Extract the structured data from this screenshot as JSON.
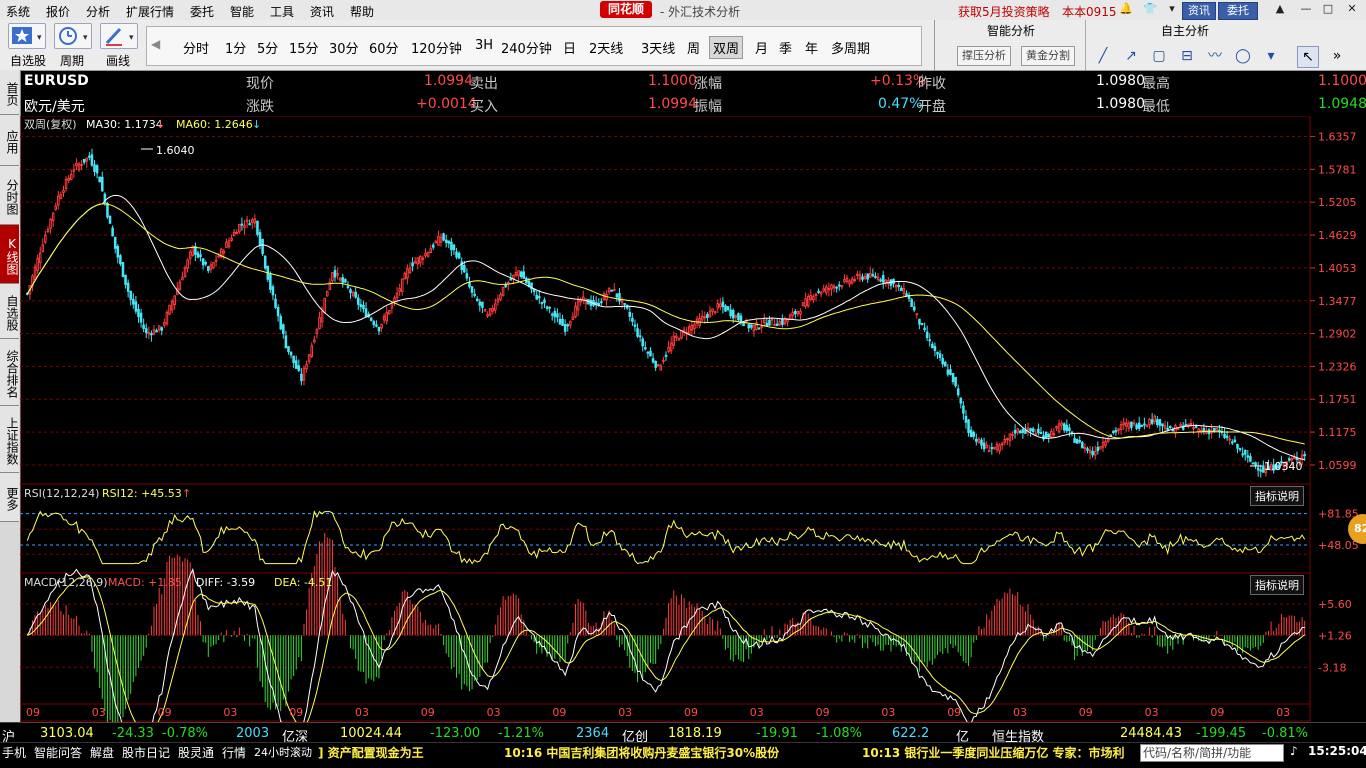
{
  "menu": [
    "系统",
    "报价",
    "分析",
    "扩展行情",
    "委托",
    "智能",
    "工具",
    "资讯",
    "帮助"
  ],
  "brand": "同花顺",
  "subtitle": "- 外汇技术分析",
  "promo": "获取5月投资策略",
  "user": "本本0915",
  "top_buttons": {
    "news": "资讯",
    "trade": "委托"
  },
  "toolbar": {
    "watchlist": "自选股",
    "period": "周期",
    "draw": "画线"
  },
  "periods": [
    "分时",
    "1分",
    "5分",
    "15分",
    "30分",
    "60分",
    "120分钟",
    "3H",
    "240分钟",
    "日",
    "2天线",
    "3天线",
    "周",
    "双周",
    "月",
    "季",
    "年",
    "多周期"
  ],
  "active_period": "双周",
  "panel": {
    "smart_title": "智能分析",
    "custom_title": "自主分析",
    "btn_pressure": "撑压分析",
    "btn_gold": "黄金分割"
  },
  "left_tabs": [
    "首页",
    "应用",
    "分时图",
    "K线图",
    "自选股",
    "综合排名",
    "上证指数",
    "更多"
  ],
  "quote": {
    "code": "EURUSD",
    "name": "欧元/美元",
    "price_label": "现价",
    "price": "1.0994",
    "change_label": "涨跌",
    "change": "+0.0014",
    "sell_label": "卖出",
    "sell": "1.1000",
    "buy_label": "买入",
    "buy": "1.0994",
    "pct_label": "涨幅",
    "pct": "+0.13%",
    "amp_label": "振幅",
    "amp": "0.47%",
    "prev_label": "昨收",
    "prev": "1.0980",
    "open_label": "开盘",
    "open": "1.0980",
    "high_label": "最高",
    "high": "1.1000",
    "low_label": "最低",
    "low": "1.0948"
  },
  "indicators": {
    "main": "双周(复权)",
    "ma30": "MA30: 1.1734",
    "ma60": "MA60: 1.2646",
    "rsi": "RSI(12,12,24)",
    "rsi12": "RSI12: +45.53",
    "macd": "MACD(12,26,9)",
    "macd_val": "MACD: +1.85",
    "diff": "DIFF: -3.59",
    "dea": "DEA: -4.51",
    "explain": "指标说明"
  },
  "colors": {
    "up": "#ff3c3c",
    "down": "#44e8f8",
    "ma30": "#ffffff",
    "ma60": "#ffff55",
    "rsi": "#ffff55",
    "grid": "#7a0000"
  },
  "chart_data": {
    "type": "candlestick",
    "price_axis": [
      "1.6357",
      "1.5781",
      "1.5205",
      "1.4629",
      "1.4053",
      "1.3477",
      "1.2902",
      "1.2326",
      "1.1751",
      "1.1175",
      "1.0599"
    ],
    "ylim": [
      1.03,
      1.64
    ],
    "high_mark": "1.6040",
    "low_mark": "1.0340",
    "rsi_axis": [
      "+81.85",
      "+48.05"
    ],
    "rsi_badge": "82",
    "macd_axis": [
      "+5.60",
      "+1.26",
      "-3.18"
    ],
    "x_ticks": [
      "09",
      "03",
      "09",
      "03",
      "09",
      "03",
      "09",
      "03",
      "09",
      "03",
      "09",
      "03",
      "09",
      "03",
      "09",
      "03",
      "09",
      "03",
      "09",
      "03"
    ],
    "anchors": [
      [
        0,
        1.36
      ],
      [
        6,
        1.45
      ],
      [
        12,
        1.53
      ],
      [
        18,
        1.58
      ],
      [
        24,
        1.6
      ],
      [
        28,
        1.56
      ],
      [
        34,
        1.44
      ],
      [
        40,
        1.35
      ],
      [
        46,
        1.29
      ],
      [
        52,
        1.3
      ],
      [
        58,
        1.37
      ],
      [
        64,
        1.44
      ],
      [
        70,
        1.4
      ],
      [
        76,
        1.44
      ],
      [
        82,
        1.48
      ],
      [
        88,
        1.49
      ],
      [
        94,
        1.37
      ],
      [
        100,
        1.27
      ],
      [
        106,
        1.21
      ],
      [
        112,
        1.3
      ],
      [
        118,
        1.4
      ],
      [
        124,
        1.37
      ],
      [
        130,
        1.33
      ],
      [
        136,
        1.3
      ],
      [
        142,
        1.35
      ],
      [
        148,
        1.41
      ],
      [
        154,
        1.43
      ],
      [
        160,
        1.46
      ],
      [
        166,
        1.43
      ],
      [
        172,
        1.36
      ],
      [
        178,
        1.32
      ],
      [
        184,
        1.37
      ],
      [
        190,
        1.4
      ],
      [
        196,
        1.36
      ],
      [
        202,
        1.33
      ],
      [
        208,
        1.3
      ],
      [
        214,
        1.35
      ],
      [
        220,
        1.34
      ],
      [
        226,
        1.37
      ],
      [
        232,
        1.33
      ],
      [
        238,
        1.27
      ],
      [
        244,
        1.23
      ],
      [
        250,
        1.28
      ],
      [
        256,
        1.3
      ],
      [
        262,
        1.32
      ],
      [
        268,
        1.34
      ],
      [
        274,
        1.32
      ],
      [
        280,
        1.3
      ],
      [
        286,
        1.31
      ],
      [
        292,
        1.31
      ],
      [
        298,
        1.33
      ],
      [
        304,
        1.36
      ],
      [
        310,
        1.37
      ],
      [
        316,
        1.38
      ],
      [
        322,
        1.39
      ],
      [
        328,
        1.39
      ],
      [
        334,
        1.38
      ],
      [
        340,
        1.36
      ],
      [
        346,
        1.3
      ],
      [
        352,
        1.25
      ],
      [
        358,
        1.21
      ],
      [
        364,
        1.12
      ],
      [
        370,
        1.09
      ],
      [
        376,
        1.09
      ],
      [
        382,
        1.12
      ],
      [
        388,
        1.12
      ],
      [
        394,
        1.11
      ],
      [
        400,
        1.13
      ],
      [
        406,
        1.1
      ],
      [
        412,
        1.08
      ],
      [
        418,
        1.11
      ],
      [
        424,
        1.13
      ],
      [
        430,
        1.13
      ],
      [
        436,
        1.14
      ],
      [
        442,
        1.12
      ],
      [
        448,
        1.13
      ],
      [
        454,
        1.12
      ],
      [
        460,
        1.12
      ],
      [
        466,
        1.1
      ],
      [
        472,
        1.07
      ],
      [
        478,
        1.05
      ],
      [
        484,
        1.06
      ],
      [
        490,
        1.07
      ],
      [
        494,
        1.08
      ]
    ]
  },
  "ticker": [
    {
      "t": "沪",
      "c": "#fff"
    },
    {
      "t": "3103.04",
      "c": "#ffff55"
    },
    {
      "t": "-24.33",
      "c": "#22dd22"
    },
    {
      "t": "-0.78%",
      "c": "#22dd22"
    },
    {
      "t": "2003",
      "c": "#44ddff"
    },
    {
      "t": "亿深",
      "c": "#fff"
    },
    {
      "t": "10024.44",
      "c": "#ffff55"
    },
    {
      "t": "-123.00",
      "c": "#22dd22"
    },
    {
      "t": "-1.21%",
      "c": "#22dd22"
    },
    {
      "t": "2364",
      "c": "#44ddff"
    },
    {
      "t": "亿创",
      "c": "#fff"
    },
    {
      "t": "1818.19",
      "c": "#ffff55"
    },
    {
      "t": "-19.91",
      "c": "#22dd22"
    },
    {
      "t": "-1.08%",
      "c": "#22dd22"
    },
    {
      "t": "622.2",
      "c": "#44ddff"
    },
    {
      "t": "亿",
      "c": "#fff"
    },
    {
      "t": "恒生指数",
      "c": "#fff"
    },
    {
      "t": "24484.43",
      "c": "#ffff55"
    },
    {
      "t": "-199.45",
      "c": "#22dd22"
    },
    {
      "t": "-0.81%",
      "c": "#22dd22"
    }
  ],
  "status": {
    "tabs": [
      "手机",
      "智能问答",
      "解盘",
      "股市日记",
      "股灵通",
      "行情",
      "24小时滚动"
    ],
    "news1": "] 资产配置现金为王",
    "news2": "10:16 中国吉利集团将收购丹麦盛宝银行30%股份",
    "news3": "10:13 银行业一季度同业压缩万亿 专家：市场利",
    "search": "代码/名称/简拼/功能",
    "clock": "15:25:04"
  }
}
